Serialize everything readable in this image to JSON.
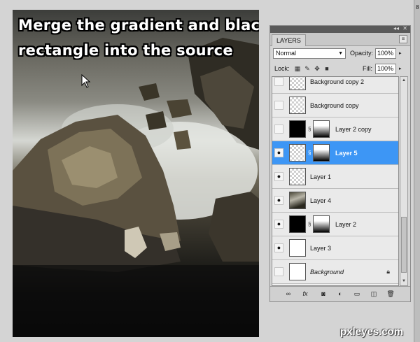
{
  "canvas": {
    "caption_line1": "Merge the gradient and black",
    "caption_line2": "rectangle into the source"
  },
  "panel": {
    "tab_label": "LAYERS",
    "blend_mode": "Normal",
    "opacity_label": "Opacity:",
    "opacity_value": "100%",
    "lock_label": "Lock:",
    "fill_label": "Fill:",
    "fill_value": "100%",
    "layers": [
      {
        "name": "Background copy 2"
      },
      {
        "name": "Background copy"
      },
      {
        "name": "Layer 2 copy"
      },
      {
        "name": "Layer 5"
      },
      {
        "name": "Layer 1"
      },
      {
        "name": "Layer 4"
      },
      {
        "name": "Layer 2"
      },
      {
        "name": "Layer 3"
      },
      {
        "name": "Background"
      }
    ]
  },
  "edge_number": "8",
  "watermark": "pxleyes.com",
  "colors": {
    "selection": "#3d96f5",
    "panel_bg": "#d6d6d6"
  }
}
